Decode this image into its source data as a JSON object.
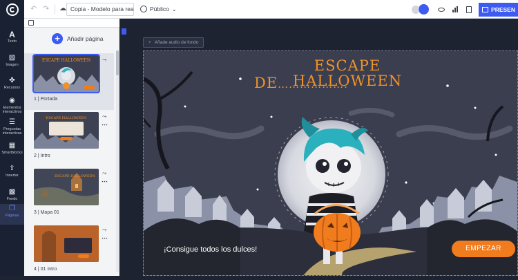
{
  "app": {
    "title_field": "Copia - Modelo para realiza...",
    "visibility": "Público",
    "present_label": "PRESEN"
  },
  "sidebar": {
    "items": [
      {
        "label": "Texto",
        "icon": "text-icon"
      },
      {
        "label": "Imagen",
        "icon": "image-icon"
      },
      {
        "label": "Recursos",
        "icon": "resources-icon"
      },
      {
        "label": "Elementos interactivos",
        "icon": "interactive-elements-icon"
      },
      {
        "label": "Preguntas interactivas",
        "icon": "interactive-questions-icon"
      },
      {
        "label": "Smartblocks",
        "icon": "smartblocks-icon"
      },
      {
        "label": "Insertar",
        "icon": "insert-icon"
      },
      {
        "label": "Fondo",
        "icon": "background-icon"
      },
      {
        "label": "Páginas",
        "icon": "pages-icon"
      }
    ]
  },
  "pages_panel": {
    "add_page_label": "Añadir página",
    "pages": [
      {
        "label": "1 | Portada"
      },
      {
        "label": "2 | Intro"
      },
      {
        "label": "3 | Mapa 01"
      },
      {
        "label": "4 | 01 Intro"
      }
    ]
  },
  "canvas": {
    "audio_button": "Añade audio de fondo",
    "slide": {
      "title_line1": "ESCAPE HALLOWEEN",
      "title_line2": "DE",
      "title_dots": "……………….",
      "caption": "¡Consigue todos los dulces!",
      "start_button": "EMPEZAR"
    }
  },
  "colors": {
    "accent": "#3d5af1",
    "sidebar_bg": "#1a2133",
    "title_orange": "#f0922b",
    "start_orange": "#f07c1e"
  }
}
